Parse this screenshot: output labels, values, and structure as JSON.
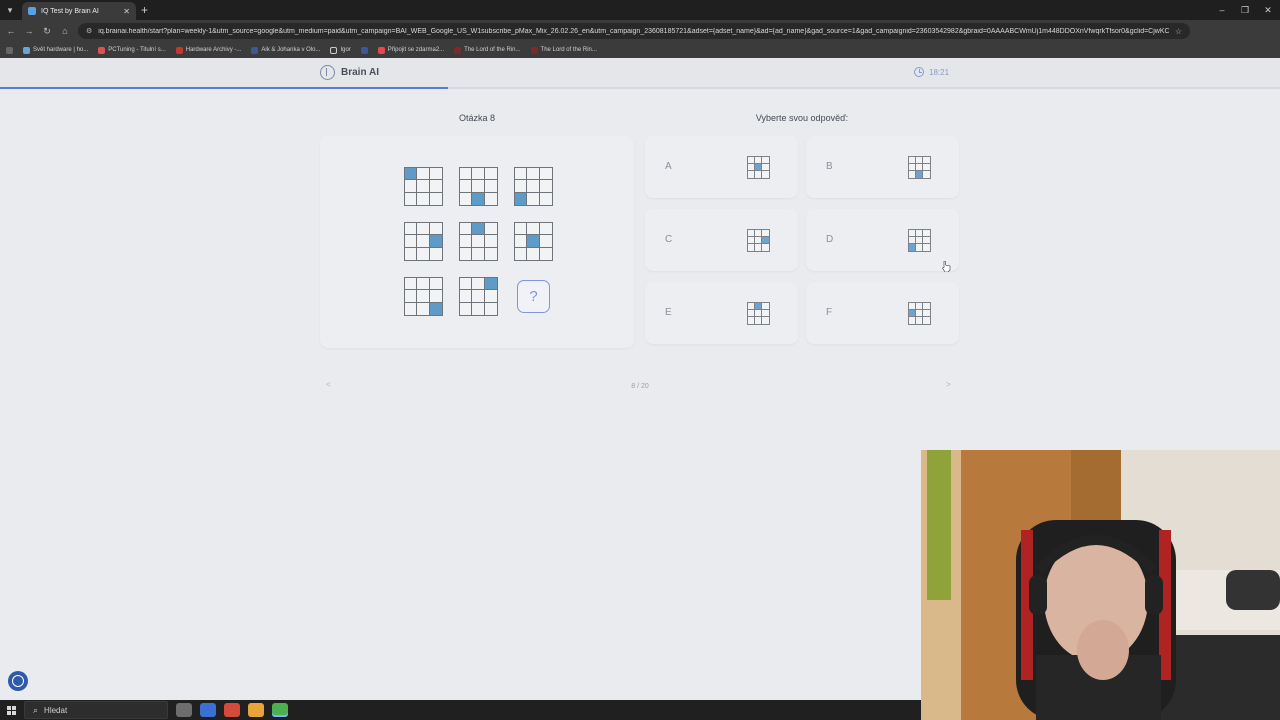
{
  "browser": {
    "tab_title": "IQ Test by Brain AI",
    "url": "iq.brainai.health/start?plan=weekly-1&utm_source=google&utm_medium=paid&utm_campaign=BAI_WEB_Google_US_W1subscribe_pMax_Mix_26.02.26_en&utm_campaign_23608185721&adset={adset_name}&ad={ad_name}&gad_source=1&gad_campaignid=23603542982&gbraid=0AAAABCWmUj1m448DDOXnVfwqrkTfsor0&gclid=CjwKCAj...",
    "bookmarks": [
      "Svět hardware | ho...",
      "PCTuning - Titulní s...",
      "Hardware Archivy -...",
      "Aik & Johanka v Olo...",
      "Igor",
      "Připojit se zdarma2...",
      "The Lord of the Rin...",
      "The Lord of the Rin..."
    ]
  },
  "app": {
    "brand": "Brain AI",
    "timer": "18:21",
    "progress_fraction": 0.35
  },
  "question": {
    "label": "Otázka 8",
    "matrix": [
      [
        0
      ],
      [
        7
      ],
      [
        6
      ],
      [
        5
      ],
      [
        1
      ],
      [
        4
      ],
      [
        8
      ],
      [
        2
      ],
      null
    ]
  },
  "answers": {
    "label": "Vyberte svou odpověď:",
    "options": [
      {
        "letter": "A",
        "filled": [
          4
        ]
      },
      {
        "letter": "B",
        "filled": [
          7
        ]
      },
      {
        "letter": "C",
        "filled": [
          5
        ]
      },
      {
        "letter": "D",
        "filled": [
          6
        ]
      },
      {
        "letter": "E",
        "filled": [
          1
        ]
      },
      {
        "letter": "F",
        "filled": [
          3
        ]
      }
    ]
  },
  "pager": {
    "prev": "<",
    "next": ">",
    "count": "8 / 20"
  },
  "taskbar": {
    "search_placeholder": "Hledat"
  },
  "colors": {
    "accent": "#5b79d6",
    "filled_cell": "#5f9bc9"
  }
}
